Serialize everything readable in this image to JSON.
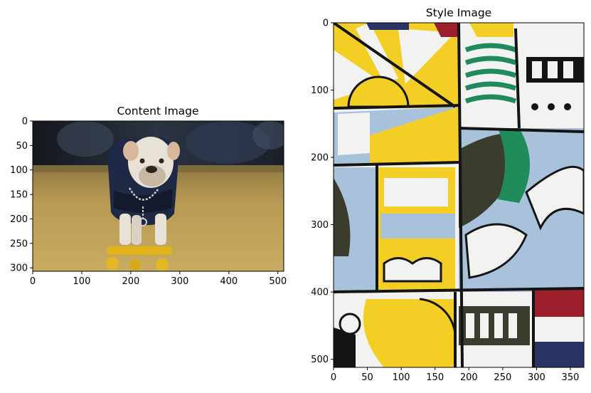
{
  "figure": {
    "background": "#ffffff",
    "panels": [
      {
        "id": "content",
        "title": "Content Image"
      },
      {
        "id": "style",
        "title": "Style Image"
      }
    ]
  },
  "chart_data": [
    {
      "type": "image",
      "title": "Content Image",
      "xlabel": "",
      "ylabel": "",
      "xlim": [
        0,
        512
      ],
      "ylim": [
        307,
        0
      ],
      "xticks": [
        0,
        100,
        200,
        300,
        400,
        500
      ],
      "yticks": [
        0,
        50,
        100,
        150,
        200,
        250,
        300
      ],
      "grid": false
    },
    {
      "type": "image",
      "title": "Style Image",
      "xlabel": "",
      "ylabel": "",
      "xlim": [
        0,
        370
      ],
      "ylim": [
        512,
        0
      ],
      "xticks": [
        0,
        50,
        100,
        150,
        200,
        250,
        300,
        350
      ],
      "yticks": [
        0,
        100,
        200,
        300,
        400,
        500
      ],
      "grid": false
    }
  ],
  "colors": {
    "arena_dark": "#1f2530",
    "floor_wood": "#b89a52",
    "dog_white": "#e8e2d6",
    "jersey_navy": "#1e2a45",
    "skateboard_yellow": "#e2b31a",
    "pop_yellow": "#f3cf25",
    "pop_blue": "#a9c2dc",
    "pop_green": "#1f8a5a",
    "pop_red": "#9a1f2a",
    "pop_navy": "#2a3366",
    "outline_black": "#141414",
    "offwhite": "#f2f3f1",
    "olive_dark": "#3a3c2e"
  }
}
